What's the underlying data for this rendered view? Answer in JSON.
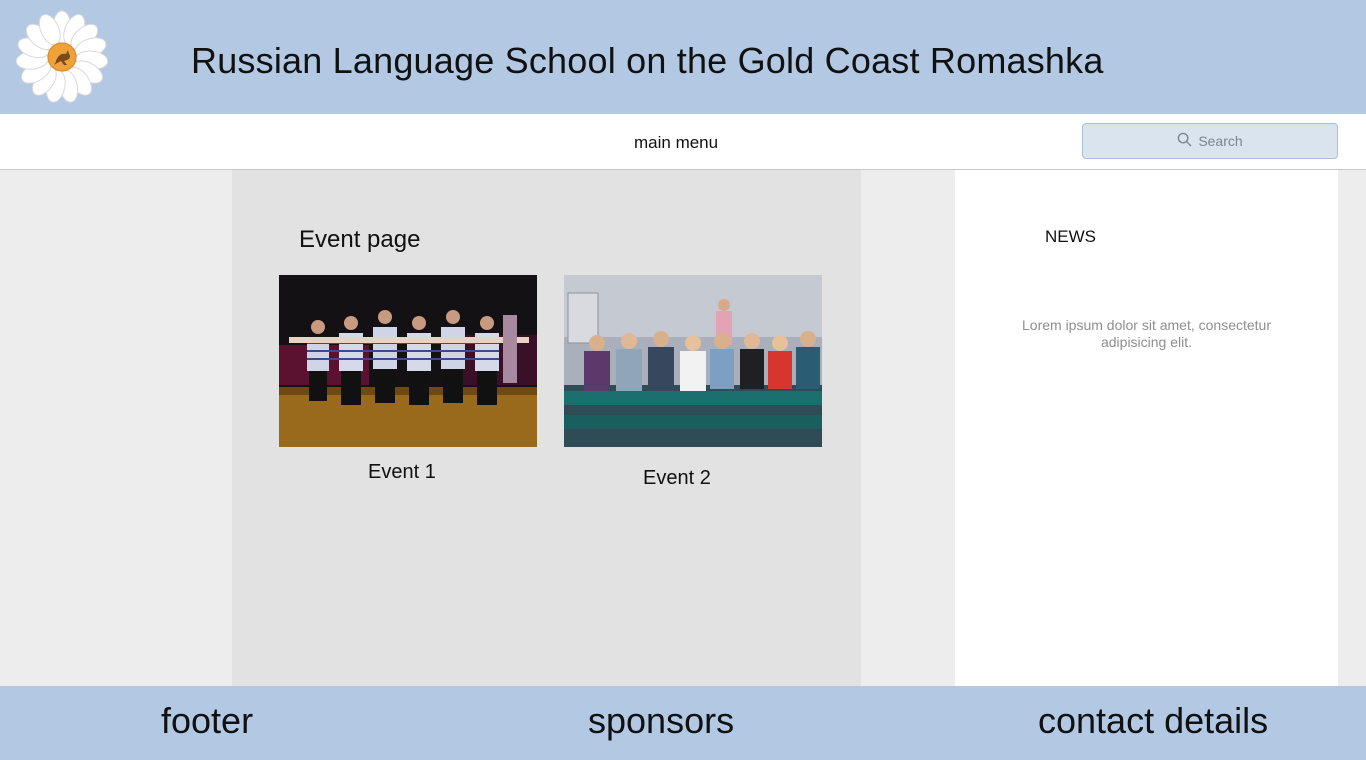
{
  "header": {
    "title": "Russian Language School on the Gold Coast Romashka",
    "logo_icon": "daisy-kangaroo-logo"
  },
  "nav": {
    "main_menu": "main menu",
    "search_placeholder": "Search",
    "search_icon": "search-icon"
  },
  "content": {
    "heading": "Event page",
    "events": [
      {
        "label": "Event 1",
        "image": "dancers-in-striped-shirts-photo"
      },
      {
        "label": "Event 2",
        "image": "audience-seated-in-classroom-photo"
      }
    ]
  },
  "news": {
    "title": "NEWS",
    "body": "Lorem ipsum dolor sit amet, consectetur adipisicing elit."
  },
  "footer": {
    "left": "footer",
    "center": "sponsors",
    "right": "contact details"
  },
  "colors": {
    "header_bg": "#b2c8e3",
    "page_bg": "#ededed",
    "content_bg": "#e2e2e2",
    "search_bg": "#dae4ef"
  }
}
